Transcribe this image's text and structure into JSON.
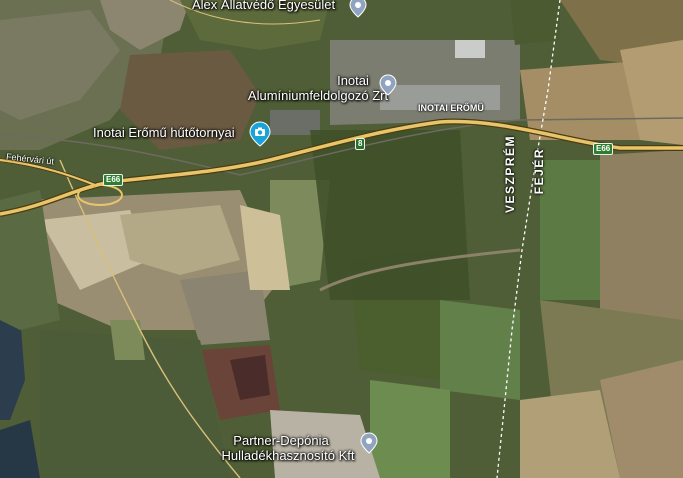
{
  "map": {
    "places": {
      "alex": "Alex Állatvédő Egyesület",
      "inotai_line1": "Inotai",
      "inotai_line2": "Alumíniumfeldolgozó Zrt",
      "hutotornyai": "Inotai Erőmű hűtőtornyai",
      "eromu": "INOTAI ERŐMŰ",
      "partner_line1": "Partner-Depónia",
      "partner_line2": "Hulladékhasznosító Kft"
    },
    "roads": {
      "street": "Fehérvári út",
      "e66_west": "E66",
      "e66_east": "E66",
      "route8": "8"
    },
    "borders": {
      "veszprem": "VESZPRÉM",
      "fejer": "FEJÉR"
    },
    "colors": {
      "road": "#e9c46a",
      "pin": "#90a4c0",
      "camera_pin": "#1aa3d9",
      "shield": "#2f7d32"
    }
  }
}
